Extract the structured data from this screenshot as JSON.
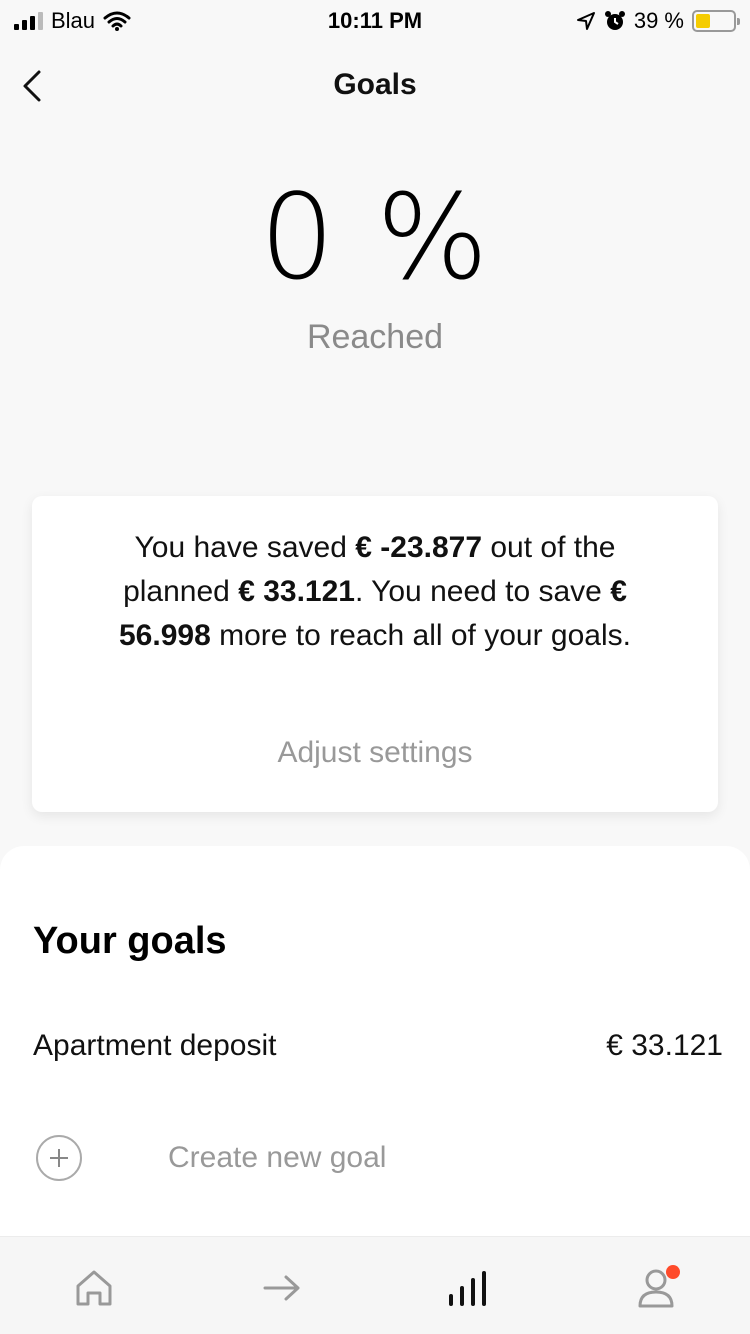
{
  "status": {
    "carrier": "Blau",
    "time": "10:11 PM",
    "battery_percent": "39 %",
    "battery_level": 0.39,
    "battery_color": "#f5cc00",
    "icons": [
      "signal-icon",
      "wifi-icon",
      "location-icon",
      "alarm-icon",
      "battery-icon"
    ]
  },
  "header": {
    "back_icon": "chevron-left-icon",
    "title": "Goals"
  },
  "progress": {
    "percent_text": "0 %",
    "caption": "Reached"
  },
  "summary": {
    "prefix": "You have saved",
    "saved_amount": "€ -23.877",
    "middle1": "out of the planned",
    "planned_amount": "€ 33.121",
    "middle2": ". You need to save",
    "needed_amount": "€ 56.998",
    "suffix": "more to reach all of your goals.",
    "adjust_link": "Adjust settings"
  },
  "goals": {
    "heading": "Your goals",
    "items": [
      {
        "name": "Apartment deposit",
        "amount": "€ 33.121"
      }
    ],
    "create_label": "Create new goal",
    "create_icon": "plus-circle-icon"
  },
  "tabbar": {
    "items": [
      {
        "icon": "home-icon",
        "active": false
      },
      {
        "icon": "arrow-right-icon",
        "active": false
      },
      {
        "icon": "bar-chart-icon",
        "active": true
      },
      {
        "icon": "profile-icon",
        "active": false,
        "badge": true
      }
    ],
    "badge_color": "#ff4b2b"
  }
}
